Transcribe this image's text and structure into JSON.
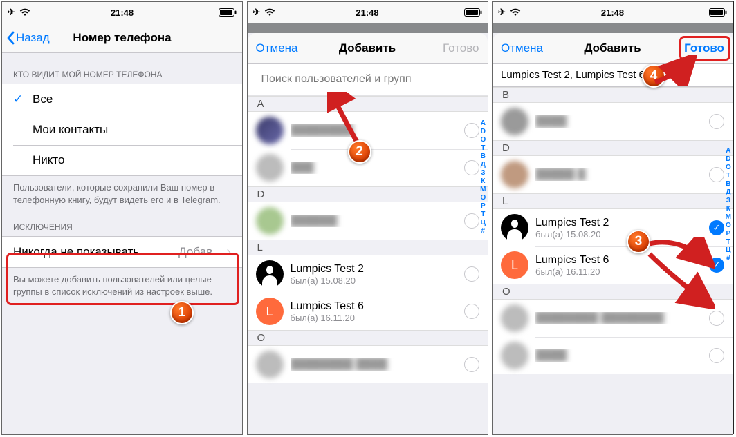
{
  "status": {
    "time": "21:48"
  },
  "screen1": {
    "back": "Назад",
    "title": "Номер телефона",
    "section1_header": "КТО ВИДИТ МОЙ НОМЕР ТЕЛЕФОНА",
    "options": {
      "all": "Все",
      "contacts": "Мои контакты",
      "nobody": "Никто"
    },
    "section1_footer": "Пользователи, которые сохранили Ваш номер в телефонную книгу, будут видеть его и в Telegram.",
    "section2_header": "ИСКЛЮЧЕНИЯ",
    "never_show": "Никогда не показывать",
    "add_label": "Добав...",
    "section2_footer": "Вы можете добавить пользователей или целые группы в список исключений из настроек выше."
  },
  "screen2": {
    "cancel": "Отмена",
    "title": "Добавить",
    "done": "Готово",
    "search_placeholder": "Поиск пользователей и групп",
    "letters": {
      "a": "A",
      "d": "D",
      "l": "L",
      "o": "O"
    },
    "contacts": {
      "lumpics2": {
        "name": "Lumpics Test 2",
        "status": "был(а) 15.08.20"
      },
      "lumpics6": {
        "name": "Lumpics Test 6",
        "status": "был(а) 16.11.20",
        "letter": "L",
        "color": "#ff6a3c"
      }
    }
  },
  "screen3": {
    "cancel": "Отмена",
    "title": "Добавить",
    "done": "Готово",
    "chips": "Lumpics Test 2,  Lumpics Test 6",
    "letters": {
      "b": "B",
      "d": "D",
      "l": "L",
      "o": "O"
    },
    "contacts": {
      "lumpics2": {
        "name": "Lumpics Test 2",
        "status": "был(а) 15.08.20"
      },
      "lumpics6": {
        "name": "Lumpics Test 6",
        "status": "был(а) 16.11.20",
        "letter": "L",
        "color": "#ff6a3c"
      }
    }
  },
  "section_index": [
    "A",
    "D",
    "O",
    "T",
    "В",
    "Д",
    "З",
    "К",
    "М",
    "О",
    "Р",
    "Т",
    "Ц",
    "#"
  ],
  "badges": {
    "1": "1",
    "2": "2",
    "3": "3",
    "4": "4"
  }
}
